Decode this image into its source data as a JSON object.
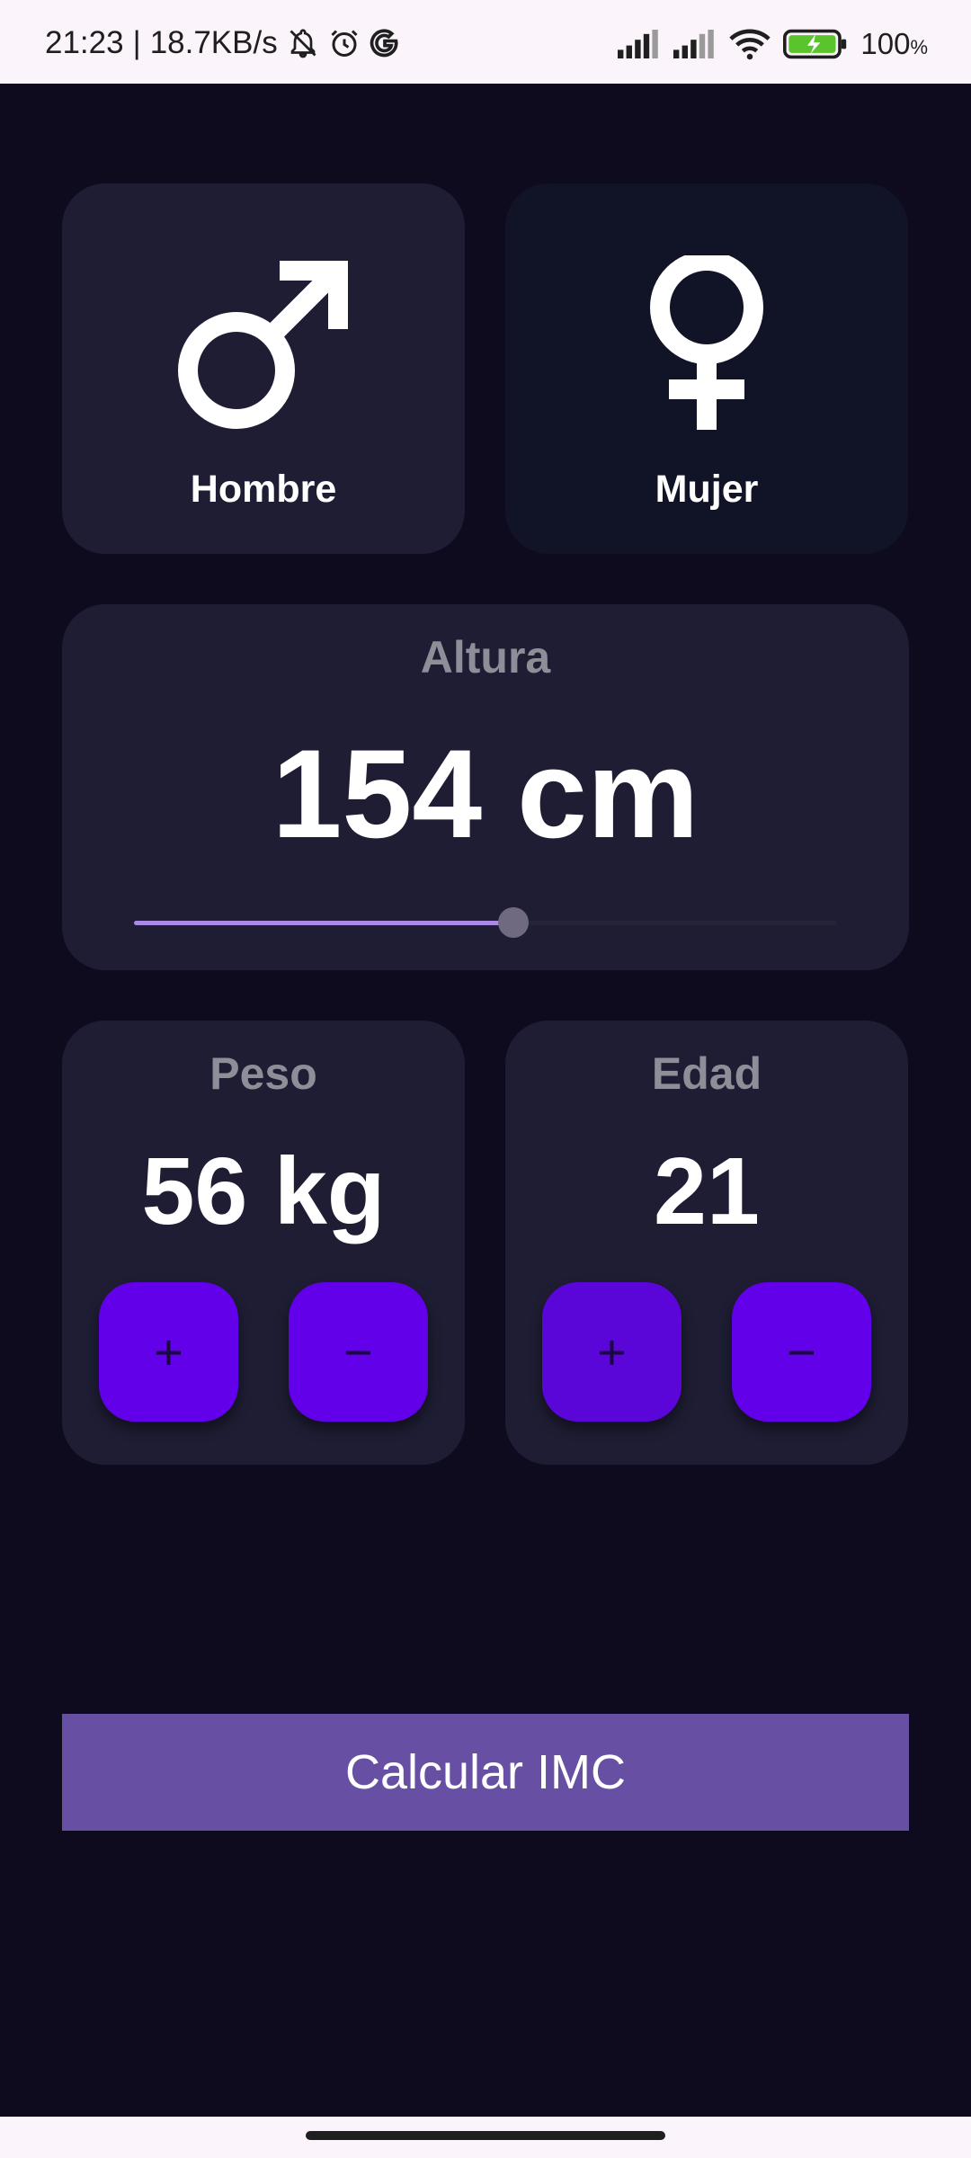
{
  "status_bar": {
    "time": "21:23",
    "separator": "|",
    "speed": "18.7KB/s",
    "battery_percent": "100",
    "battery_unit": "%",
    "icons": [
      "bell-off-icon",
      "alarm-icon",
      "google-icon",
      "signal-icon",
      "signal-icon",
      "wifi-icon",
      "battery-charging-icon"
    ]
  },
  "gender": {
    "male_label": "Hombre",
    "female_label": "Mujer",
    "selected": "male"
  },
  "height": {
    "title": "Altura",
    "value_text": "154 cm",
    "slider_fraction": 0.54
  },
  "weight": {
    "title": "Peso",
    "value_text": "56 kg",
    "plus_label": "+",
    "minus_label": "−"
  },
  "age": {
    "title": "Edad",
    "value_text": "21",
    "plus_label": "+",
    "minus_label": "−"
  },
  "calculate_label": "Calcular IMC",
  "colors": {
    "background": "#0e0b1f",
    "card_selected": "#1e1d33",
    "card_unselected": "#111326",
    "accent_button": "#6200ea",
    "primary_button": "#6750a4",
    "slider_active": "#a988e6"
  }
}
